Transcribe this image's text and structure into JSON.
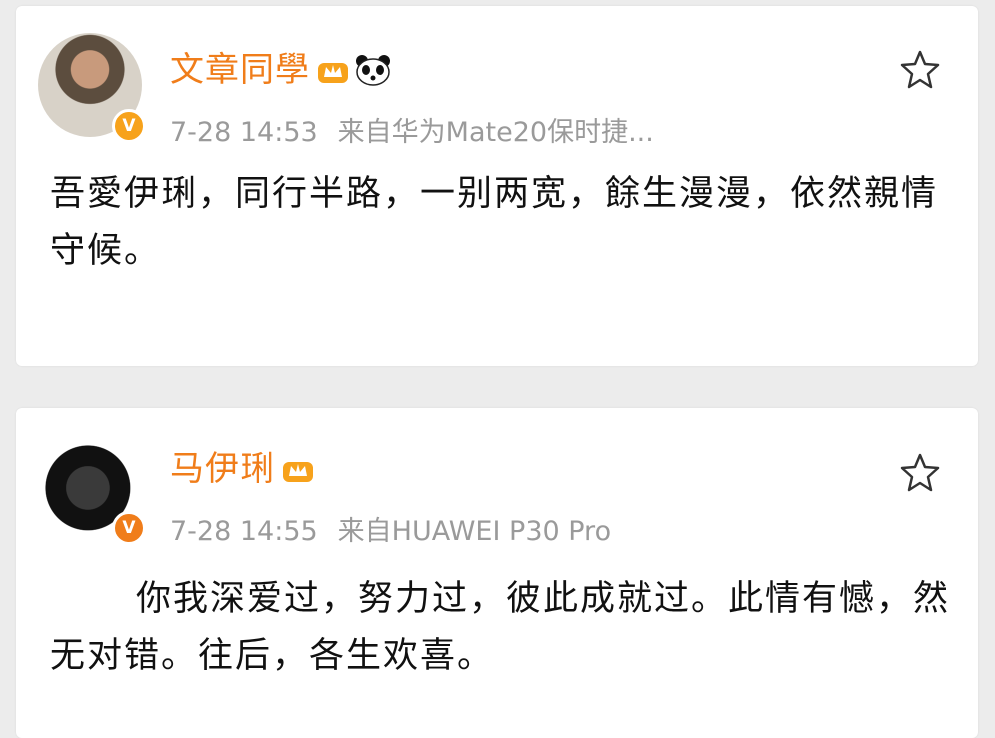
{
  "posts": [
    {
      "author": "文章同學",
      "time": "7-28 14:53",
      "source": "来自华为Mate20保时捷...",
      "text": "吾愛伊琍，同行半路，一别两宽，餘生漫漫，依然親情守候。",
      "verified_badge": "V",
      "icons": [
        "vip-crown-icon",
        "panda-icon",
        "star-icon"
      ]
    },
    {
      "author": "马伊琍",
      "time": "7-28 14:55",
      "source": "来自HUAWEI P30 Pro",
      "text": "你我深爱过，努力过，彼此成就过。此情有憾，然无对错。往后，各生欢喜。",
      "verified_badge": "V",
      "icons": [
        "vip-crown-icon",
        "star-icon"
      ]
    }
  ],
  "colors": {
    "name": "#f07d1a",
    "meta": "#9a9a9a",
    "badge": "#f7a21b",
    "background": "#ececec",
    "card": "#ffffff"
  }
}
